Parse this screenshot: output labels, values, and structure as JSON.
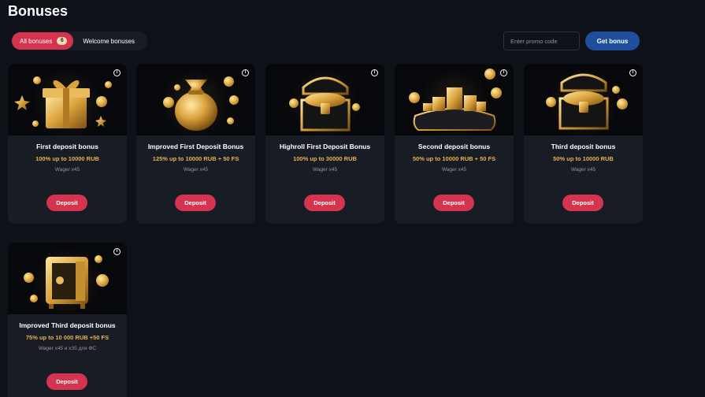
{
  "page": {
    "title": "Bonuses"
  },
  "tabs": {
    "all_label": "All bonuses",
    "all_count": "6",
    "welcome_label": "Welcome bonuses"
  },
  "promo": {
    "placeholder": "Enter promo code",
    "button_label": "Get bonus"
  },
  "cards": [
    {
      "title": "First deposit bonus",
      "amount": "100% up to 10000 RUB",
      "wager": "Wager x45",
      "button": "Deposit",
      "icon": "gift-box-icon"
    },
    {
      "title": "Improved First Deposit Bonus",
      "amount": "125% up to 10000 RUB + 50 FS",
      "wager": "Wager x45",
      "button": "Deposit",
      "icon": "money-bag-icon"
    },
    {
      "title": "Highroll First Deposit Bonus",
      "amount": "100% up to 30000 RUB",
      "wager": "Wager x45",
      "button": "Deposit",
      "icon": "treasure-chest-icon"
    },
    {
      "title": "Second deposit bonus",
      "amount": "50% up to 10000 RUB + 50 FS",
      "wager": "Wager x45",
      "button": "Deposit",
      "icon": "coin-pillow-icon"
    },
    {
      "title": "Third deposit bonus",
      "amount": "50% up to 10000 RUB",
      "wager": "Wager x45",
      "button": "Deposit",
      "icon": "treasure-chest-icon"
    },
    {
      "title": "Improved Third deposit bonus",
      "amount": "75% up to 10 000 RUB +50 FS",
      "wager": "Wager x45 и x35 для ФС",
      "button": "Deposit",
      "icon": "safe-icon"
    }
  ],
  "colors": {
    "background": "#0e1118",
    "card": "#181c25",
    "accent": "#d5344f",
    "gold": "#e8b24e",
    "primary_button": "#1f4e9c"
  }
}
